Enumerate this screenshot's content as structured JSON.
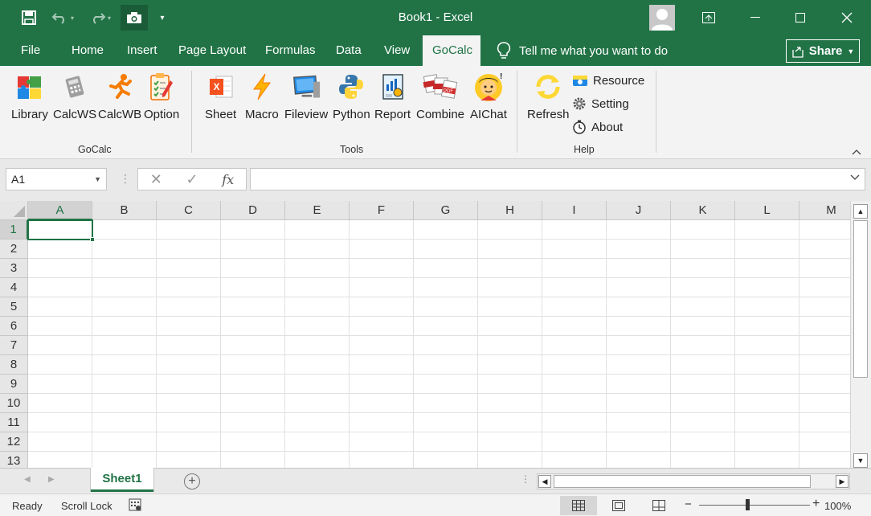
{
  "window": {
    "title": "Book1  -  Excel"
  },
  "menu": {
    "tabs": [
      "File",
      "Home",
      "Insert",
      "Page Layout",
      "Formulas",
      "Data",
      "View",
      "GoCalc"
    ],
    "active_tab": "GoCalc",
    "tell_me": "Tell me what you want to do",
    "share": "Share"
  },
  "ribbon": {
    "groups": {
      "gocalc": {
        "label": "GoCalc",
        "buttons": [
          "Library",
          "CalcWS",
          "CalcWB",
          "Option"
        ]
      },
      "tools": {
        "label": "Tools",
        "buttons": [
          "Sheet",
          "Macro",
          "Fileview",
          "Python",
          "Report",
          "Combine",
          "AIChat"
        ]
      },
      "help": {
        "label": "Help",
        "big_button": "Refresh",
        "small_buttons": [
          "Resource",
          "Setting",
          "About"
        ]
      }
    }
  },
  "formula_bar": {
    "name_box": "A1",
    "fx": "fx",
    "content": ""
  },
  "grid": {
    "columns": [
      "A",
      "B",
      "C",
      "D",
      "E",
      "F",
      "G",
      "H",
      "I",
      "J",
      "K",
      "L",
      "M"
    ],
    "rows": [
      "1",
      "2",
      "3",
      "4",
      "5",
      "6",
      "7",
      "8",
      "9",
      "10",
      "11",
      "12",
      "13"
    ],
    "active_cell": "A1"
  },
  "sheets": {
    "tabs": [
      "Sheet1"
    ],
    "active": "Sheet1"
  },
  "status": {
    "ready": "Ready",
    "scroll_lock": "Scroll Lock",
    "zoom": "100%"
  },
  "colors": {
    "excel_green": "#217346",
    "ribbon_bg": "#f3f3f3"
  }
}
